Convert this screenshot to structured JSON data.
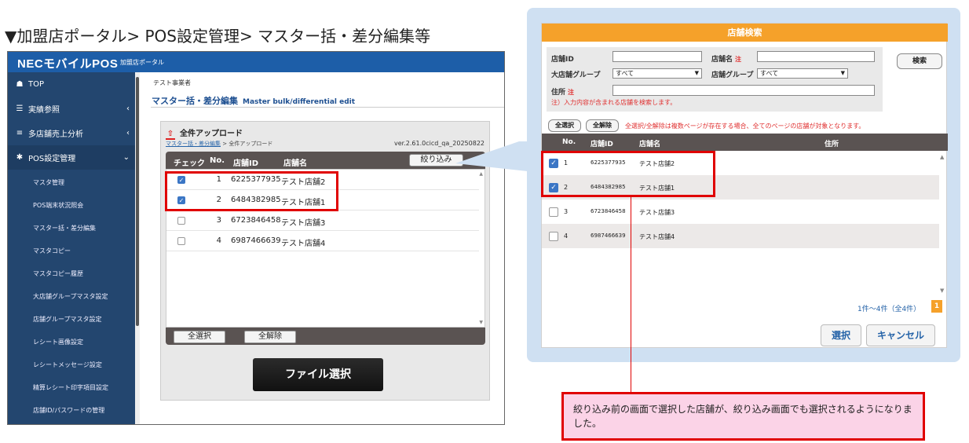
{
  "caption": "▼加盟店ポータル> POS設定管理> マスター括・差分編集等",
  "app": {
    "title": "NECモバイルPOS",
    "subtitle": "加盟店ポータル"
  },
  "sidebar": {
    "items": [
      {
        "icon": "tachometer-icon",
        "glyph": "☗",
        "label": "TOP"
      },
      {
        "icon": "list-icon",
        "glyph": "☰",
        "label": "実績参照",
        "chevron": "‹"
      },
      {
        "icon": "database-icon",
        "glyph": "≡",
        "label": "多店舗売上分析",
        "chevron": "‹"
      },
      {
        "icon": "gear-icon",
        "glyph": "✱",
        "label": "POS設定管理",
        "chevron": "⌄"
      }
    ],
    "subitems": [
      "マスタ管理",
      "POS端末状況照会",
      "マスター括・差分編集",
      "マスタコピー",
      "マスタコピー履歴",
      "大店舗グループマスタ設定",
      "店舗グループマスタ設定",
      "レシート画像設定",
      "レシートメッセージ設定",
      "精算レシート印字項目設定",
      "店舗ID/パスワードの管理"
    ]
  },
  "content": {
    "business_name": "テスト事業者",
    "title": "マスター括・差分編集",
    "title_en": "Master bulk/differential edit",
    "panel_title": "全件アップロード",
    "upload_icon": "upload-icon",
    "breadcrumb_link": "マスター括・差分編集",
    "breadcrumb_rest": " > 全件アップロード",
    "version": "ver.2.61.0cicd_qa_20250822",
    "table": {
      "headers": [
        "チェック",
        "No.",
        "店舗ID",
        "店舗名"
      ],
      "filter_label": "絞り込み",
      "rows": [
        {
          "checked": true,
          "no": "1",
          "id": "6225377935",
          "name": "テスト店舗2"
        },
        {
          "checked": true,
          "no": "2",
          "id": "6484382985",
          "name": "テスト店舗1"
        },
        {
          "checked": false,
          "no": "3",
          "id": "6723846458",
          "name": "テスト店舗3"
        },
        {
          "checked": false,
          "no": "4",
          "id": "6987466639",
          "name": "テスト店舗4"
        }
      ],
      "select_all": "全選択",
      "deselect_all": "全解除"
    },
    "file_button": "ファイル選択"
  },
  "dialog": {
    "title": "店舗検索",
    "labels": {
      "store_id": "店舗ID",
      "store_name": "店舗名",
      "req": "注",
      "big_group": "大店舗グループ",
      "group": "店舗グループ",
      "address": "住所"
    },
    "big_group_value": "すべて",
    "group_value": "すべて",
    "search_note": "注）入力内容が含まれる店舗を検索します。",
    "search_button": "検索",
    "select_all": "全選択",
    "deselect_all": "全解除",
    "bulk_note": "全選択/全解除は複数ページが存在する場合、全てのページの店舗が対象となります。",
    "headers": [
      "No.",
      "店舗ID",
      "店舗名",
      "住所"
    ],
    "rows": [
      {
        "checked": true,
        "no": "1",
        "id": "6225377935",
        "name": "テスト店舗2"
      },
      {
        "checked": true,
        "no": "2",
        "id": "6484382985",
        "name": "テスト店舗1"
      },
      {
        "checked": false,
        "no": "3",
        "id": "6723846458",
        "name": "テスト店舗3"
      },
      {
        "checked": false,
        "no": "4",
        "id": "6987466639",
        "name": "テスト店舗4"
      }
    ],
    "count": "1件～4件（全4件）",
    "page": "1",
    "ok": "選択",
    "cancel": "キャンセル"
  },
  "note": "絞り込み前の画面で選択した店舗が、絞り込み画面でも選択されるようになりました。",
  "colors": {
    "header_blue": "#1d5ea8",
    "sidebar": "#23466f",
    "dialog_orange": "#f5a12a",
    "highlight_red": "#e00000",
    "note_pink": "#fbd3e7"
  }
}
